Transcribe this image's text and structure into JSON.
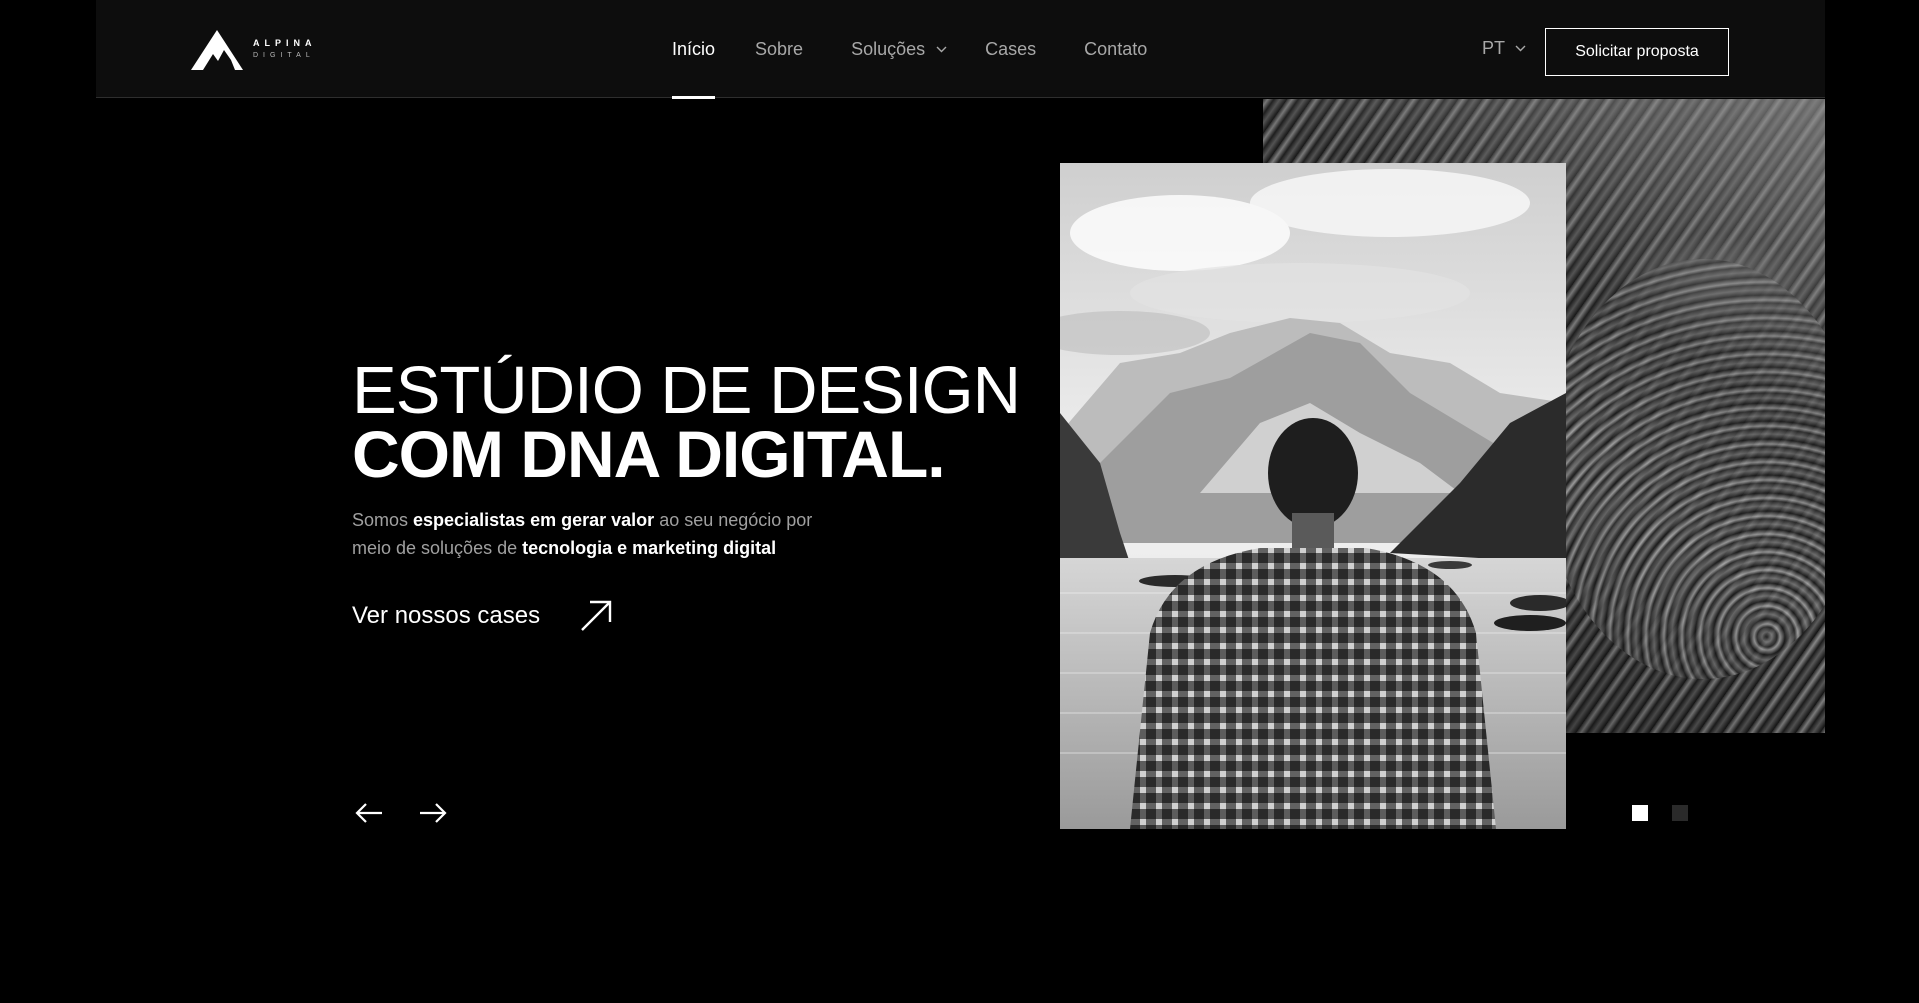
{
  "header": {
    "logo": {
      "word": "ALPINA",
      "sub": "DIGITAL",
      "icon": "mountain-logo-icon"
    },
    "nav": [
      {
        "label": "Início",
        "active": true
      },
      {
        "label": "Sobre",
        "active": false
      },
      {
        "label": "Soluções",
        "active": false,
        "has_dropdown": true
      },
      {
        "label": "Cases",
        "active": false
      },
      {
        "label": "Contato",
        "active": false
      }
    ],
    "language": "PT",
    "cta_label": "Solicitar proposta"
  },
  "hero": {
    "title_line1": "ESTÚDIO DE DESIGN",
    "title_line2": "COM DNA DIGITAL.",
    "desc_part1": "Somos ",
    "desc_bold1": "especialistas em gerar valor",
    "desc_part2": " ao seu negócio por meio de soluções de ",
    "desc_bold2": "tecnologia e marketing digital",
    "cases_link": "Ver nossos cases"
  },
  "slider": {
    "prev_icon": "arrow-left-icon",
    "next_icon": "arrow-right-icon",
    "slide_count": 2,
    "active_slide": 1
  },
  "colors": {
    "background": "#000000",
    "header": "#0d0d0d",
    "text": "#ffffff",
    "muted": "#a0a0a0"
  }
}
